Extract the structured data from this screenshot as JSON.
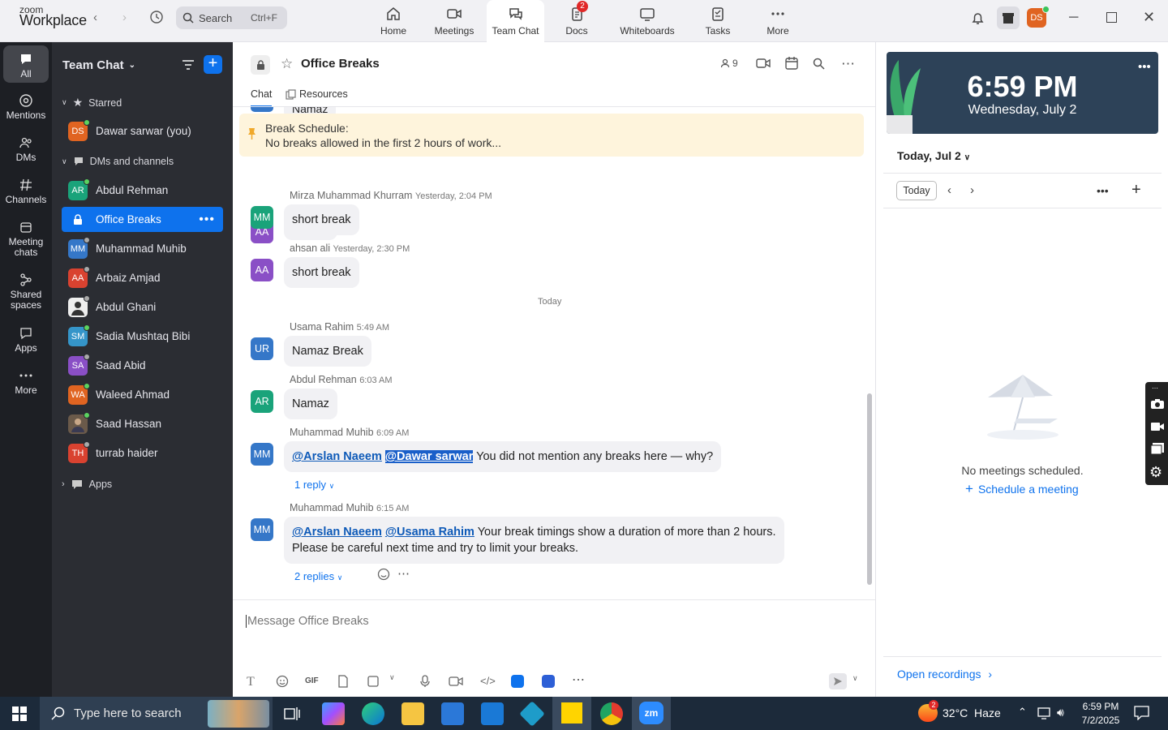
{
  "topbar": {
    "brand_small": "zoom",
    "brand_big": "Workplace",
    "search_label": "Search",
    "search_shortcut": "Ctrl+F",
    "tabs": [
      {
        "label": "Home",
        "icon": "home-icon"
      },
      {
        "label": "Meetings",
        "icon": "video-icon"
      },
      {
        "label": "Team Chat",
        "icon": "chat-icon"
      },
      {
        "label": "Docs",
        "icon": "docs-icon",
        "badge": "2"
      },
      {
        "label": "Whiteboards",
        "icon": "whiteboard-icon"
      },
      {
        "label": "Tasks",
        "icon": "tasks-icon"
      },
      {
        "label": "More",
        "icon": "more-icon"
      }
    ],
    "user_initials": "DS"
  },
  "rail": [
    {
      "label": "All",
      "icon": "chat-bubble-icon"
    },
    {
      "label": "Mentions",
      "icon": "at-icon"
    },
    {
      "label": "DMs",
      "icon": "people-icon"
    },
    {
      "label": "Channels",
      "icon": "hash-icon"
    },
    {
      "label": "Meeting chats",
      "icon": "calendar-icon"
    },
    {
      "label": "Shared spaces",
      "icon": "share-icon"
    },
    {
      "label": "Apps",
      "icon": "apps-icon"
    },
    {
      "label": "More",
      "icon": "ellipsis-icon"
    }
  ],
  "sidebar": {
    "title": "Team Chat",
    "starred_label": "Starred",
    "self_entry": {
      "initials": "DS",
      "name": "Dawar sarwar (you)",
      "color": "#e06421"
    },
    "dms_label": "DMs and channels",
    "apps_label": "Apps",
    "items": [
      {
        "initials": "AR",
        "name": "Abdul Rehman",
        "color": "#1aa37a",
        "status": "#5bd35f"
      },
      {
        "initials": "",
        "name": "Office Breaks",
        "color": "",
        "status": ""
      },
      {
        "initials": "MM",
        "name": "Muhammad Muhib",
        "color": "#3577c8",
        "status": "#aaaaaa"
      },
      {
        "initials": "AA",
        "name": "Arbaiz Amjad",
        "color": "#d94230",
        "status": "#aaaaaa"
      },
      {
        "initials": "",
        "name": "Abdul Ghani",
        "color": "#ffffff",
        "status": "#aaaaaa"
      },
      {
        "initials": "SM",
        "name": "Sadia Mushtaq Bibi",
        "color": "#3595c9",
        "status": "#5bd35f"
      },
      {
        "initials": "SA",
        "name": "Saad Abid",
        "color": "#8a4fc6",
        "status": "#aaaaaa"
      },
      {
        "initials": "WA",
        "name": "Waleed Ahmad",
        "color": "#e06421",
        "status": "#5bd35f"
      },
      {
        "initials": "",
        "name": "Saad Hassan",
        "color": "#6b5a4a",
        "status": "#5bd35f"
      },
      {
        "initials": "TH",
        "name": "turrab haider",
        "color": "#d94230",
        "status": "#aaaaaa"
      }
    ]
  },
  "channel": {
    "title": "Office Breaks",
    "member_count": "9",
    "tabs": {
      "chat": "Chat",
      "resources": "Resources"
    },
    "pinned_title": "Break Schedule:",
    "pinned_text": "No breaks allowed in the first 2 hours of work...",
    "clipped_text": "Namaz",
    "date_divider": "Today",
    "messages": [
      {
        "initials": "AA",
        "color": "#8a4fc6",
        "sender": "",
        "time": "",
        "text": "namaz"
      },
      {
        "initials": "MM",
        "color": "#1aa37a",
        "sender": "Mirza Muhammad Khurram",
        "time": "Yesterday, 2:04 PM",
        "text": "short break"
      },
      {
        "initials": "AA",
        "color": "#8a4fc6",
        "sender": "ahsan ali",
        "time": "Yesterday, 2:30 PM",
        "text": "short break"
      },
      {
        "initials": "UR",
        "color": "#3577c8",
        "sender": "Usama Rahim",
        "time": "5:49 AM",
        "text": "Namaz Break"
      },
      {
        "initials": "AR",
        "color": "#1aa37a",
        "sender": "Abdul Rehman",
        "time": "6:03 AM",
        "text": "Namaz"
      },
      {
        "initials": "MM",
        "color": "#3577c8",
        "sender": "Muhammad Muhib",
        "time": "6:09 AM",
        "mention1": "@Arslan Naeem",
        "mention2": "@Dawar sarwar",
        "text": "You did not mention any breaks here — why?",
        "replies": "1 reply"
      },
      {
        "initials": "MM",
        "color": "#3577c8",
        "sender": "Muhammad Muhib",
        "time": "6:15 AM",
        "mention1": "@Arslan Naeem",
        "mention2": "@Usama Rahim",
        "text": "Your break timings show a duration of more than 2 hours.",
        "text2": "Please be careful next time and try to limit your breaks.",
        "replies": "2 replies"
      }
    ],
    "composer_placeholder": "Message Office Breaks"
  },
  "calendar": {
    "time": "6:59 PM",
    "date": "Wednesday, July 2",
    "day_selector": "Today, Jul 2",
    "today_button": "Today",
    "empty_text": "No meetings scheduled.",
    "schedule_link": "Schedule a meeting",
    "recordings_link": "Open recordings"
  },
  "taskbar": {
    "search_placeholder": "Type here to search",
    "weather": "32°C  Haze",
    "weather_badge": "2",
    "time": "6:59 PM",
    "date": "7/2/2025"
  },
  "colors": {
    "accent": "#0e72ed",
    "sidebar": "#2b2d33",
    "rail": "#1d1f24"
  }
}
